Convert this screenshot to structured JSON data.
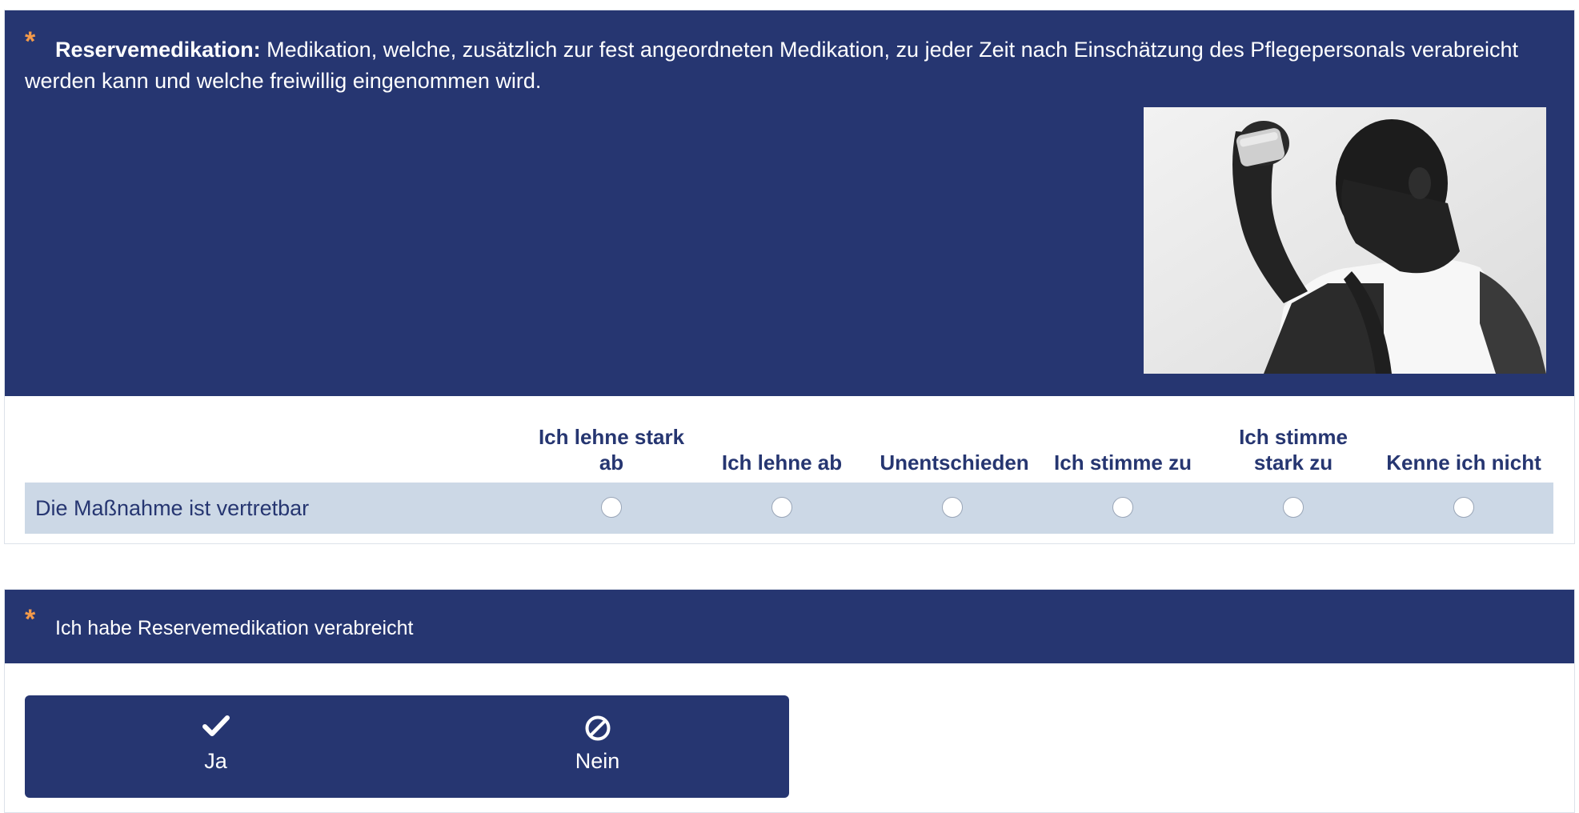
{
  "question1": {
    "required_mark": "*",
    "term": "Reservemedikation:",
    "definition": "Medikation, welche, zusätzlich zur fest angeordneten Medikation, zu jeder Zeit nach Einschätzung des Pflegepersonals verabreicht werden kann und welche freiwillig eingenommen wird.",
    "image_icon": "photo-person-drinking-from-cup",
    "columns": [
      {
        "label": "Ich lehne stark ab"
      },
      {
        "label": "Ich lehne ab"
      },
      {
        "label": "Unentschieden"
      },
      {
        "label": "Ich stimme zu"
      },
      {
        "label": "Ich stimme stark zu"
      },
      {
        "label": "Kenne ich nicht"
      }
    ],
    "row": {
      "label": "Die Maßnahme ist vertretbar",
      "selected": null
    }
  },
  "question2": {
    "required_mark": "*",
    "label": "Ich habe Reservemedikation verabreicht",
    "options": [
      {
        "label": "Ja",
        "icon": "checkmark-icon"
      },
      {
        "label": "Nein",
        "icon": "prohibited-icon"
      }
    ],
    "selected": null
  },
  "colors": {
    "header_bg": "#263671",
    "accent_required": "#f39a4a",
    "row_bg": "#ccd8e6",
    "text_dark": "#263671"
  }
}
